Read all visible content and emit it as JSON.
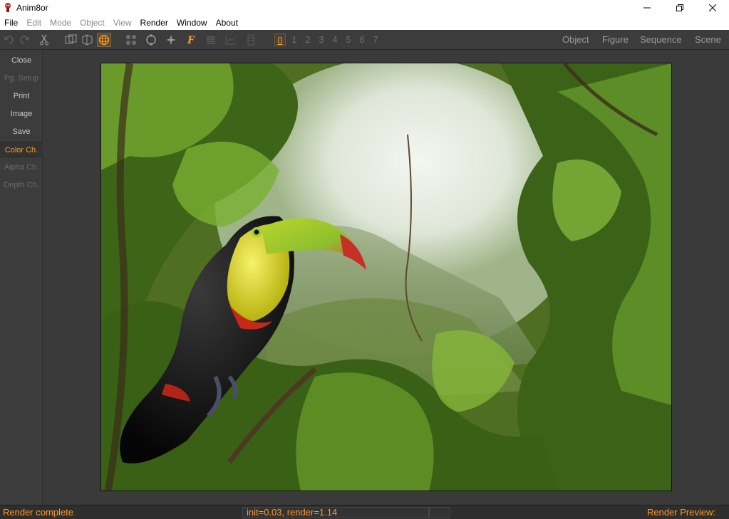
{
  "window": {
    "title": "Anim8or",
    "icon": "anim8or-logo-icon",
    "controls": [
      "minimize-icon",
      "restore-icon",
      "close-icon"
    ]
  },
  "menu": {
    "items": [
      {
        "label": "File",
        "enabled": true
      },
      {
        "label": "Edit",
        "enabled": false
      },
      {
        "label": "Mode",
        "enabled": false
      },
      {
        "label": "Object",
        "enabled": false
      },
      {
        "label": "View",
        "enabled": false
      },
      {
        "label": "Render",
        "enabled": true
      },
      {
        "label": "Window",
        "enabled": true
      },
      {
        "label": "About",
        "enabled": true
      }
    ]
  },
  "toolbar": {
    "icons": [
      "undo-icon",
      "redo-icon",
      "cut-icon",
      "views-icon",
      "copy-view-icon",
      "render-sphere-icon",
      "grid-dots-icon",
      "rotate-icon",
      "lights-icon",
      "fx-icon",
      "list-icon",
      "graph-icon",
      "panel-icon"
    ],
    "layer_numbers": [
      "0",
      "1",
      "2",
      "3",
      "4",
      "5",
      "6",
      "7"
    ],
    "active_layer": "0",
    "mode_tabs": [
      "Object",
      "Figure",
      "Sequence",
      "Scene"
    ]
  },
  "side_panel": {
    "buttons": [
      {
        "label": "Close",
        "state": "normal"
      },
      {
        "label": "Pg. Setup",
        "state": "disabled"
      },
      {
        "label": "Print",
        "state": "normal"
      },
      {
        "label": "Image",
        "state": "normal"
      },
      {
        "label": "Save",
        "state": "normal"
      },
      {
        "label": "Color Ch.",
        "state": "active"
      },
      {
        "label": "Alpha Ch.",
        "state": "disabled"
      },
      {
        "label": "Depth Ch.",
        "state": "disabled"
      }
    ]
  },
  "render": {
    "image_subject": "toucan-in-jungle-render"
  },
  "status": {
    "message": "Render complete",
    "timing": "init=0.03, render=1.14",
    "preview_label": "Render Preview:"
  },
  "colors": {
    "accent": "#ff9a1f",
    "panel": "#3c3c3c",
    "background": "#3a3a3a"
  }
}
